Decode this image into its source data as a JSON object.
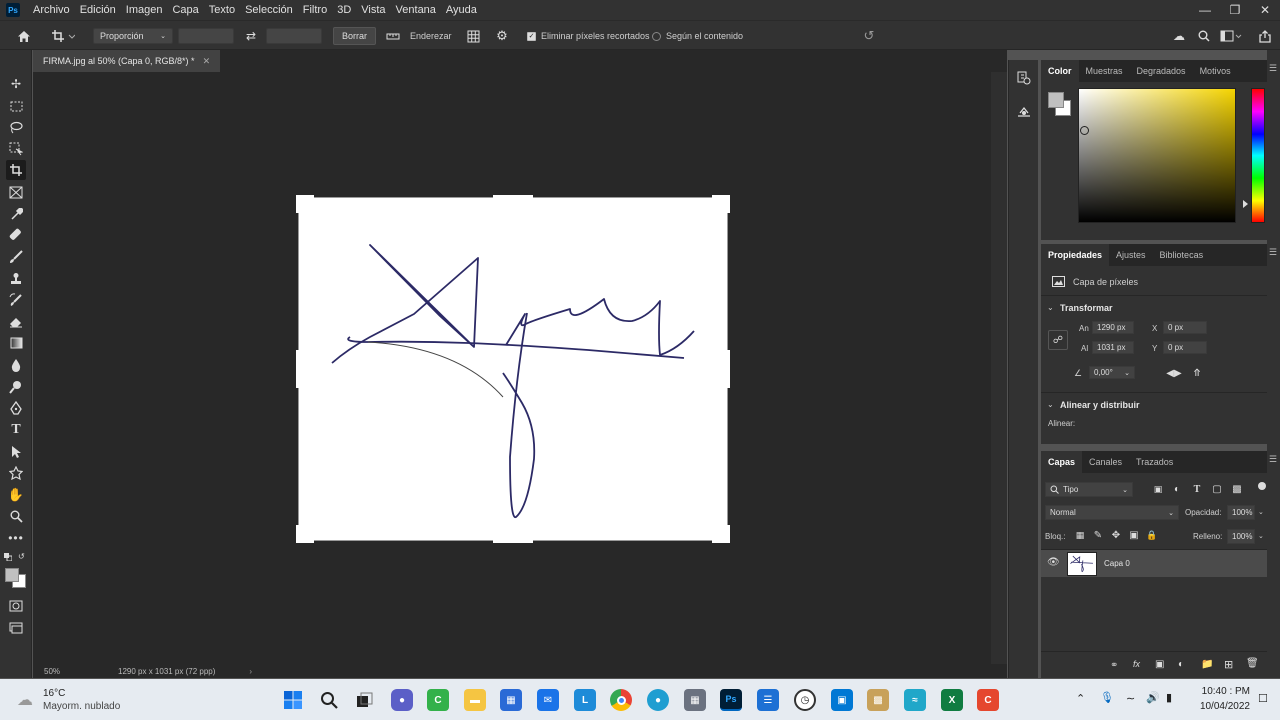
{
  "app": {
    "logo": "Ps",
    "menu": [
      "Archivo",
      "Edición",
      "Imagen",
      "Capa",
      "Texto",
      "Selección",
      "Filtro",
      "3D",
      "Vista",
      "Ventana",
      "Ayuda"
    ]
  },
  "options_bar": {
    "ratio_label": "Proporción",
    "clear_label": "Borrar",
    "straighten_label": "Enderezar",
    "delete_cropped_label": "Eliminar píxeles recortados",
    "content_aware_label": "Según el contenido"
  },
  "document": {
    "tab_title": "FIRMA.jpg al 50% (Capa 0, RGB/8*) *",
    "zoom": "50%",
    "status_info": "1290 px x 1031 px (72 ppp)"
  },
  "color_panel": {
    "tabs": [
      "Color",
      "Muestras",
      "Degradados",
      "Motivos"
    ],
    "hue_color": "#f5d400"
  },
  "properties_panel": {
    "tabs": [
      "Propiedades",
      "Ajustes",
      "Bibliotecas"
    ],
    "layer_type": "Capa de píxeles",
    "transform_title": "Transformar",
    "w_label": "An",
    "w_value": "1290 px",
    "h_label": "Al",
    "h_value": "1031 px",
    "x_label": "X",
    "x_value": "0 px",
    "y_label": "Y",
    "y_value": "0 px",
    "angle_value": "0,00°",
    "align_title": "Alinear y distribuir",
    "align_label": "Alinear:"
  },
  "layers_panel": {
    "tabs": [
      "Capas",
      "Canales",
      "Trazados"
    ],
    "filter_label": "Tipo",
    "blend_mode": "Normal",
    "opacity_label": "Opacidad:",
    "opacity_value": "100%",
    "lock_label": "Bloq.:",
    "fill_label": "Relleno:",
    "fill_value": "100%",
    "layers": [
      {
        "name": "Capa 0"
      }
    ]
  },
  "taskbar": {
    "temperature": "16°C",
    "weather": "Mayorm. nublado",
    "time": "10:40 : PM",
    "date": "10/04/2022"
  }
}
